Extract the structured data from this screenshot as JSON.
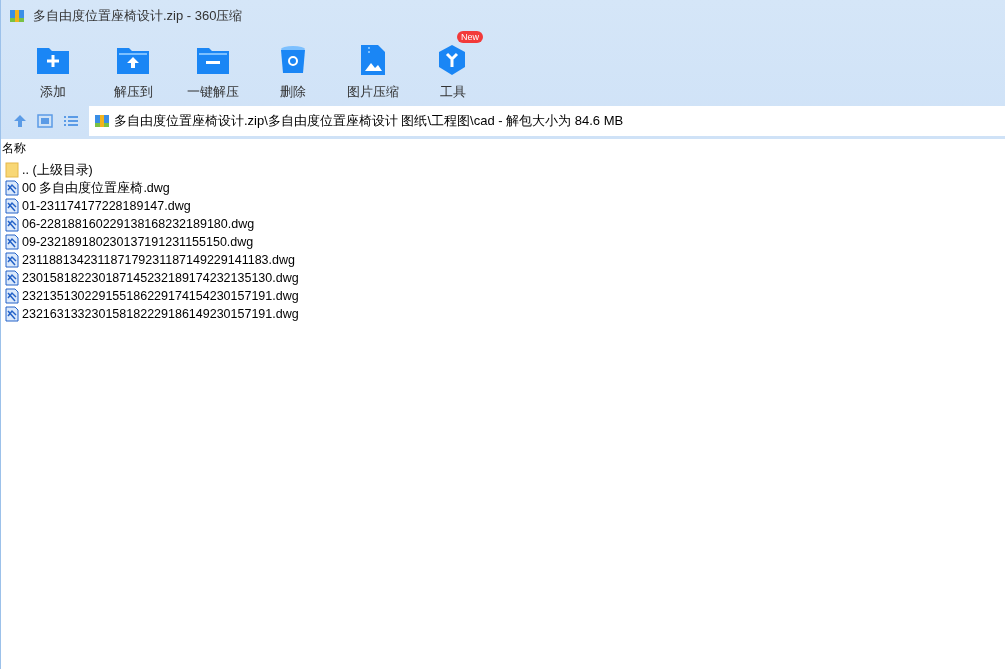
{
  "window": {
    "title": "多自由度位置座椅设计.zip - 360压缩"
  },
  "toolbar": [
    {
      "kind": "add",
      "label": "添加"
    },
    {
      "kind": "extract",
      "label": "解压到"
    },
    {
      "kind": "oneclick",
      "label": "一键解压"
    },
    {
      "kind": "delete",
      "label": "删除"
    },
    {
      "kind": "image",
      "label": "图片压缩"
    },
    {
      "kind": "tools",
      "label": "工具",
      "badge": "New"
    }
  ],
  "address": {
    "path": "多自由度位置座椅设计.zip\\多自由度位置座椅设计 图纸\\工程图\\cad - 解包大小为 84.6 MB"
  },
  "table": {
    "columns": [
      "名称"
    ],
    "rows": [
      {
        "kind": "folder",
        "name": ".. (上级目录)"
      },
      {
        "kind": "dwg",
        "name": "00 多自由度位置座椅.dwg"
      },
      {
        "kind": "dwg",
        "name": "01-231174177228189147.dwg"
      },
      {
        "kind": "dwg",
        "name": "06-228188160229138168232189180.dwg"
      },
      {
        "kind": "dwg",
        "name": "09-232189180230137191231155150.dwg"
      },
      {
        "kind": "dwg",
        "name": "231188134231187179231187149229141183.dwg"
      },
      {
        "kind": "dwg",
        "name": "230158182230187145232189174232135130.dwg"
      },
      {
        "kind": "dwg",
        "name": "232135130229155186229174154230157191.dwg"
      },
      {
        "kind": "dwg",
        "name": "232163133230158182229186149230157191.dwg"
      }
    ]
  }
}
